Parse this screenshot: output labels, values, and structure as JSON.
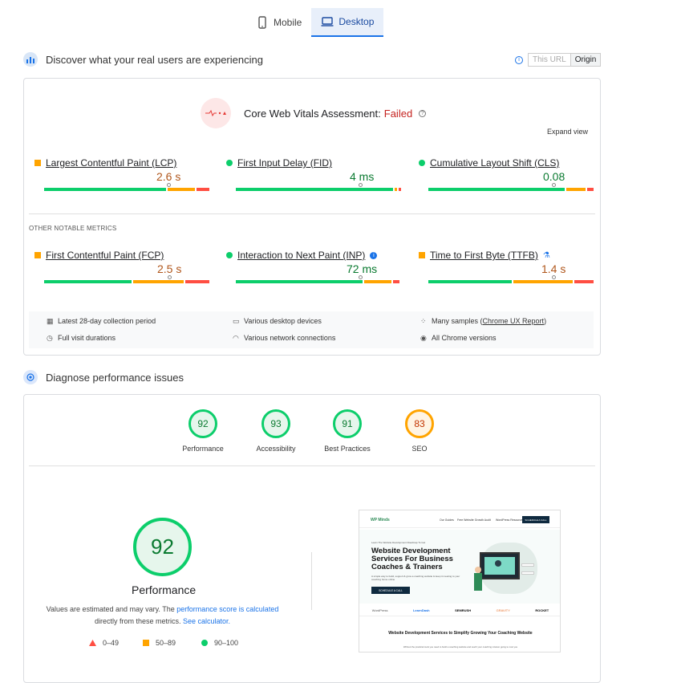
{
  "tabs": {
    "mobile": "Mobile",
    "desktop": "Desktop"
  },
  "crux": {
    "heading": "Discover what your real users are experiencing",
    "toggle": {
      "this_url": "This URL",
      "origin": "Origin"
    },
    "assessment_label": "Core Web Vitals Assessment:",
    "assessment_status": "Failed",
    "expand": "Expand view",
    "metrics": [
      {
        "name": "Largest Contentful Paint (LCP)",
        "value": "2.6 s",
        "status": "needs-improvement"
      },
      {
        "name": "First Input Delay (FID)",
        "value": "4 ms",
        "status": "good"
      },
      {
        "name": "Cumulative Layout Shift (CLS)",
        "value": "0.08",
        "status": "good"
      }
    ],
    "other_title": "OTHER NOTABLE METRICS",
    "other_metrics": [
      {
        "name": "First Contentful Paint (FCP)",
        "value": "2.5 s",
        "status": "needs-improvement"
      },
      {
        "name": "Interaction to Next Paint (INP)",
        "value": "72 ms",
        "status": "good"
      },
      {
        "name": "Time to First Byte (TTFB)",
        "value": "1.4 s",
        "status": "needs-improvement"
      }
    ],
    "footer": {
      "period": "Latest 28-day collection period",
      "devices": "Various desktop devices",
      "samples_prefix": "Many samples (",
      "samples_link": "Chrome UX Report",
      "samples_suffix": ")",
      "durations": "Full visit durations",
      "network": "Various network connections",
      "chrome": "All Chrome versions"
    }
  },
  "lighthouse": {
    "heading": "Diagnose performance issues",
    "scores": [
      {
        "value": "92",
        "label": "Performance",
        "color": "#0cce6b"
      },
      {
        "value": "93",
        "label": "Accessibility",
        "color": "#0cce6b"
      },
      {
        "value": "91",
        "label": "Best Practices",
        "color": "#0cce6b"
      },
      {
        "value": "83",
        "label": "SEO",
        "color": "#ffa400"
      }
    ],
    "big_score": "92",
    "big_label": "Performance",
    "note_1": "Values are estimated and may vary. The ",
    "note_link1": "performance score is calculated",
    "note_2": "directly from these metrics. ",
    "note_link2": "See calculator.",
    "legend": {
      "poor": "0–49",
      "avg": "50–89",
      "good": "90–100"
    },
    "screenshot": {
      "logo": "WP Minds",
      "nav": [
        "Our Guides",
        "Free Website Growth Audit",
        "WordPress Resources"
      ],
      "nav_btn": "SCHEDULE A CALL",
      "eyebrow": "Learn The Website Development Roadmap To Get",
      "title": "Website Development Services For Business Coaches & Trainers",
      "sub": "A simple way to build, support & grow a coaching website & keep it meeting to your coaching home online",
      "cta": "SCHEDULE A CALL",
      "logos": [
        "WordPress",
        "LearnDash",
        "SEMRUSH",
        "GRAVITY",
        "ROCKET"
      ],
      "bottom_title": "Website Development Services to Simplify Growing Your Coaching Website",
      "bottom_sub": "Without the practical tools you need to build a coaching website and reach your coaching mission going to cost you"
    }
  },
  "colors": {
    "good": "#0cce6b",
    "avg": "#ffa400",
    "poor": "#ff4e42",
    "fail": "#c5221f",
    "link": "#1a73e8"
  }
}
